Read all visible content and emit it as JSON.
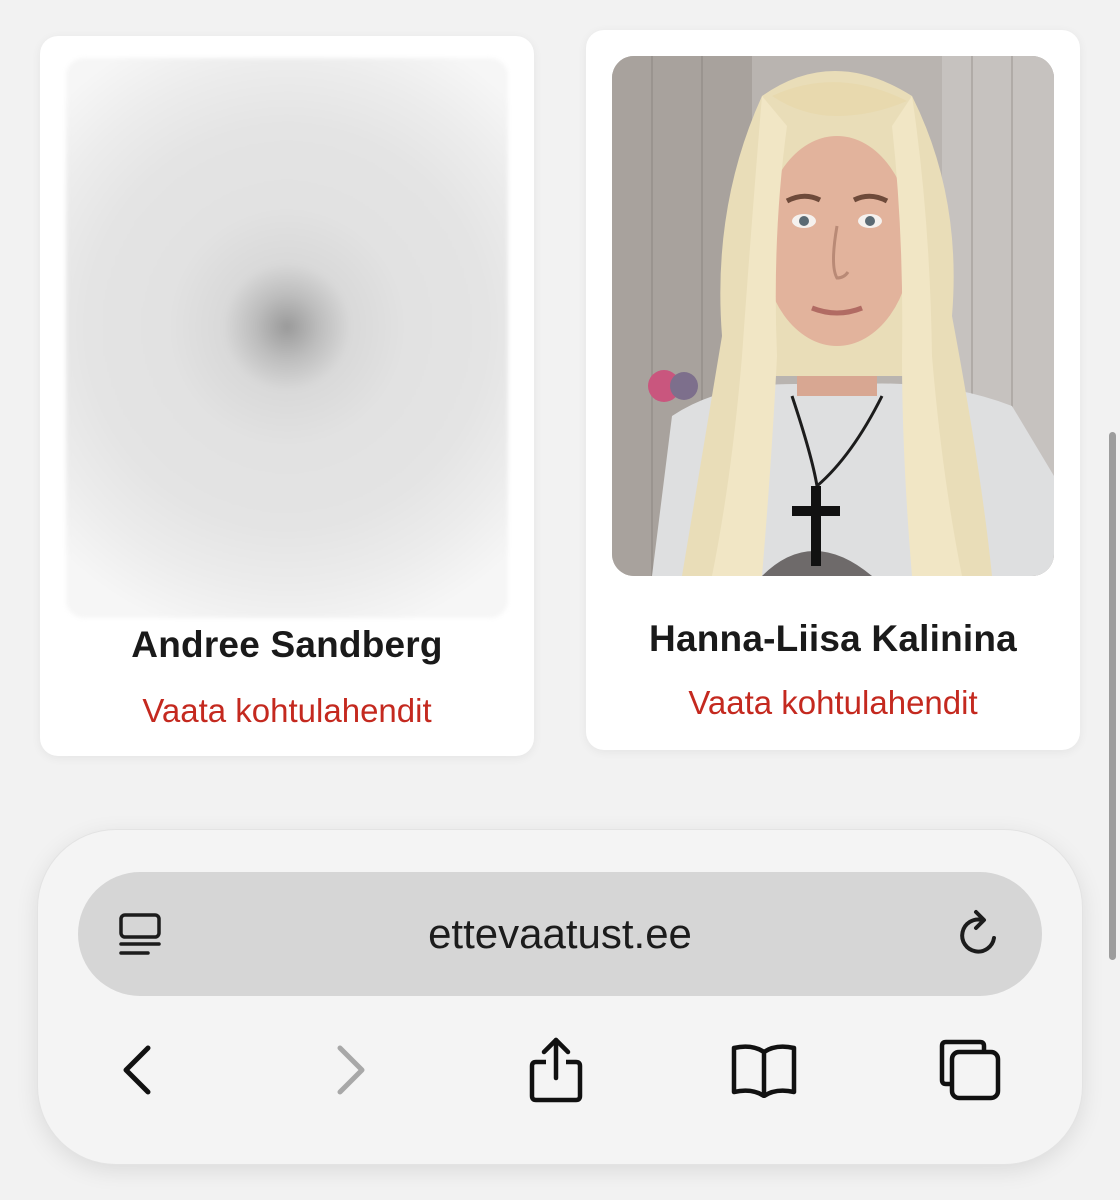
{
  "profiles": [
    {
      "name": "Andree Sandberg",
      "link_label": "Vaata kohtulahendit",
      "photo": "blurred-photo-placeholder"
    },
    {
      "name": "Hanna-Liisa Kalinina",
      "link_label": "Vaata kohtulahendit",
      "photo": "portrait-photo"
    }
  ],
  "browser": {
    "address": "ettevaatust.ee",
    "icons": {
      "reader": "reader-mode-icon",
      "reload": "reload-icon",
      "back": "chevron-left-icon",
      "forward": "chevron-right-icon",
      "share": "share-icon",
      "bookmarks": "book-icon",
      "tabs": "tabs-icon"
    },
    "forward_enabled": false
  },
  "colors": {
    "background": "#f2f2f2",
    "card": "#ffffff",
    "link": "#c4291f",
    "addressbar": "#d6d6d6",
    "disabled_icon": "#a8a8a8"
  }
}
